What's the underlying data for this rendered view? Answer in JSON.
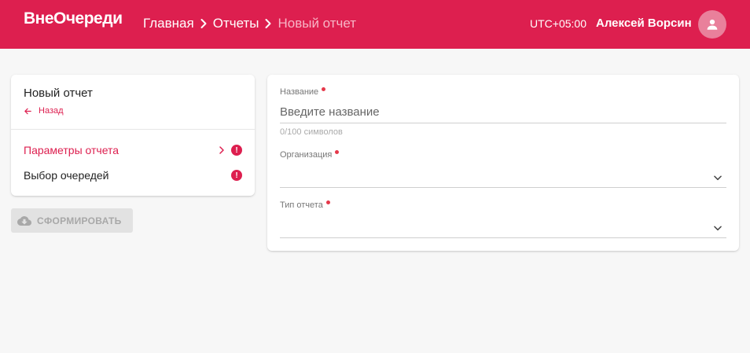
{
  "header": {
    "logo": "ВнеОчереди",
    "breadcrumbs": [
      "Главная",
      "Отчеты",
      "Новый отчет"
    ],
    "timezone": "UTC+05:00",
    "user_name": "Алексей Ворсин",
    "avatar_icon": "person-icon"
  },
  "sidebar": {
    "title": "Новый отчет",
    "back_label": "Назад",
    "steps": [
      {
        "label": "Параметры отчета",
        "active": true,
        "has_error": true
      },
      {
        "label": "Выбор очередей",
        "active": false,
        "has_error": true
      }
    ],
    "error_glyph": "!"
  },
  "generate_button": {
    "label": "СФОРМИРОВАТЬ",
    "icon": "cloud-download-icon",
    "disabled": true
  },
  "form": {
    "name": {
      "label": "Название",
      "placeholder": "Введите название",
      "value": "",
      "counter": "0/100 символов"
    },
    "organization": {
      "label": "Организация",
      "value": ""
    },
    "report_type": {
      "label": "Тип отчета",
      "value": ""
    }
  },
  "colors": {
    "accent": "#dd1f4f",
    "required_dot": "#e5384a",
    "background": "#f7f7f7"
  }
}
